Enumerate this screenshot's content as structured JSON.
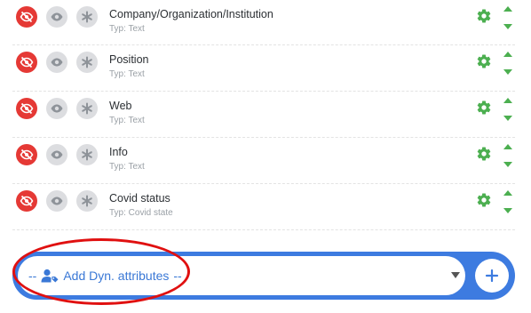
{
  "rows": [
    {
      "name": "Company/Organization/Institution",
      "type": "Typ: Text"
    },
    {
      "name": "Position",
      "type": "Typ: Text"
    },
    {
      "name": "Web",
      "type": "Typ: Text"
    },
    {
      "name": "Info",
      "type": "Typ: Text"
    },
    {
      "name": "Covid status",
      "type": "Typ: Covid state"
    }
  ],
  "icons": {
    "hide": "eye-slash-icon",
    "visible": "eye-icon",
    "required": "asterisk-icon",
    "settings": "gear-icon",
    "reorder": "up-down-arrows-icon",
    "attribute": "user-tag-icon",
    "add": "plus-icon"
  },
  "add_attributes": {
    "prefix": "--",
    "label": "Add Dyn. attributes",
    "suffix": "--"
  },
  "colors": {
    "hide_red": "#e53935",
    "gear_green": "#4caf50",
    "accent_blue": "#3d7be0",
    "annotation_red": "#e01010"
  }
}
